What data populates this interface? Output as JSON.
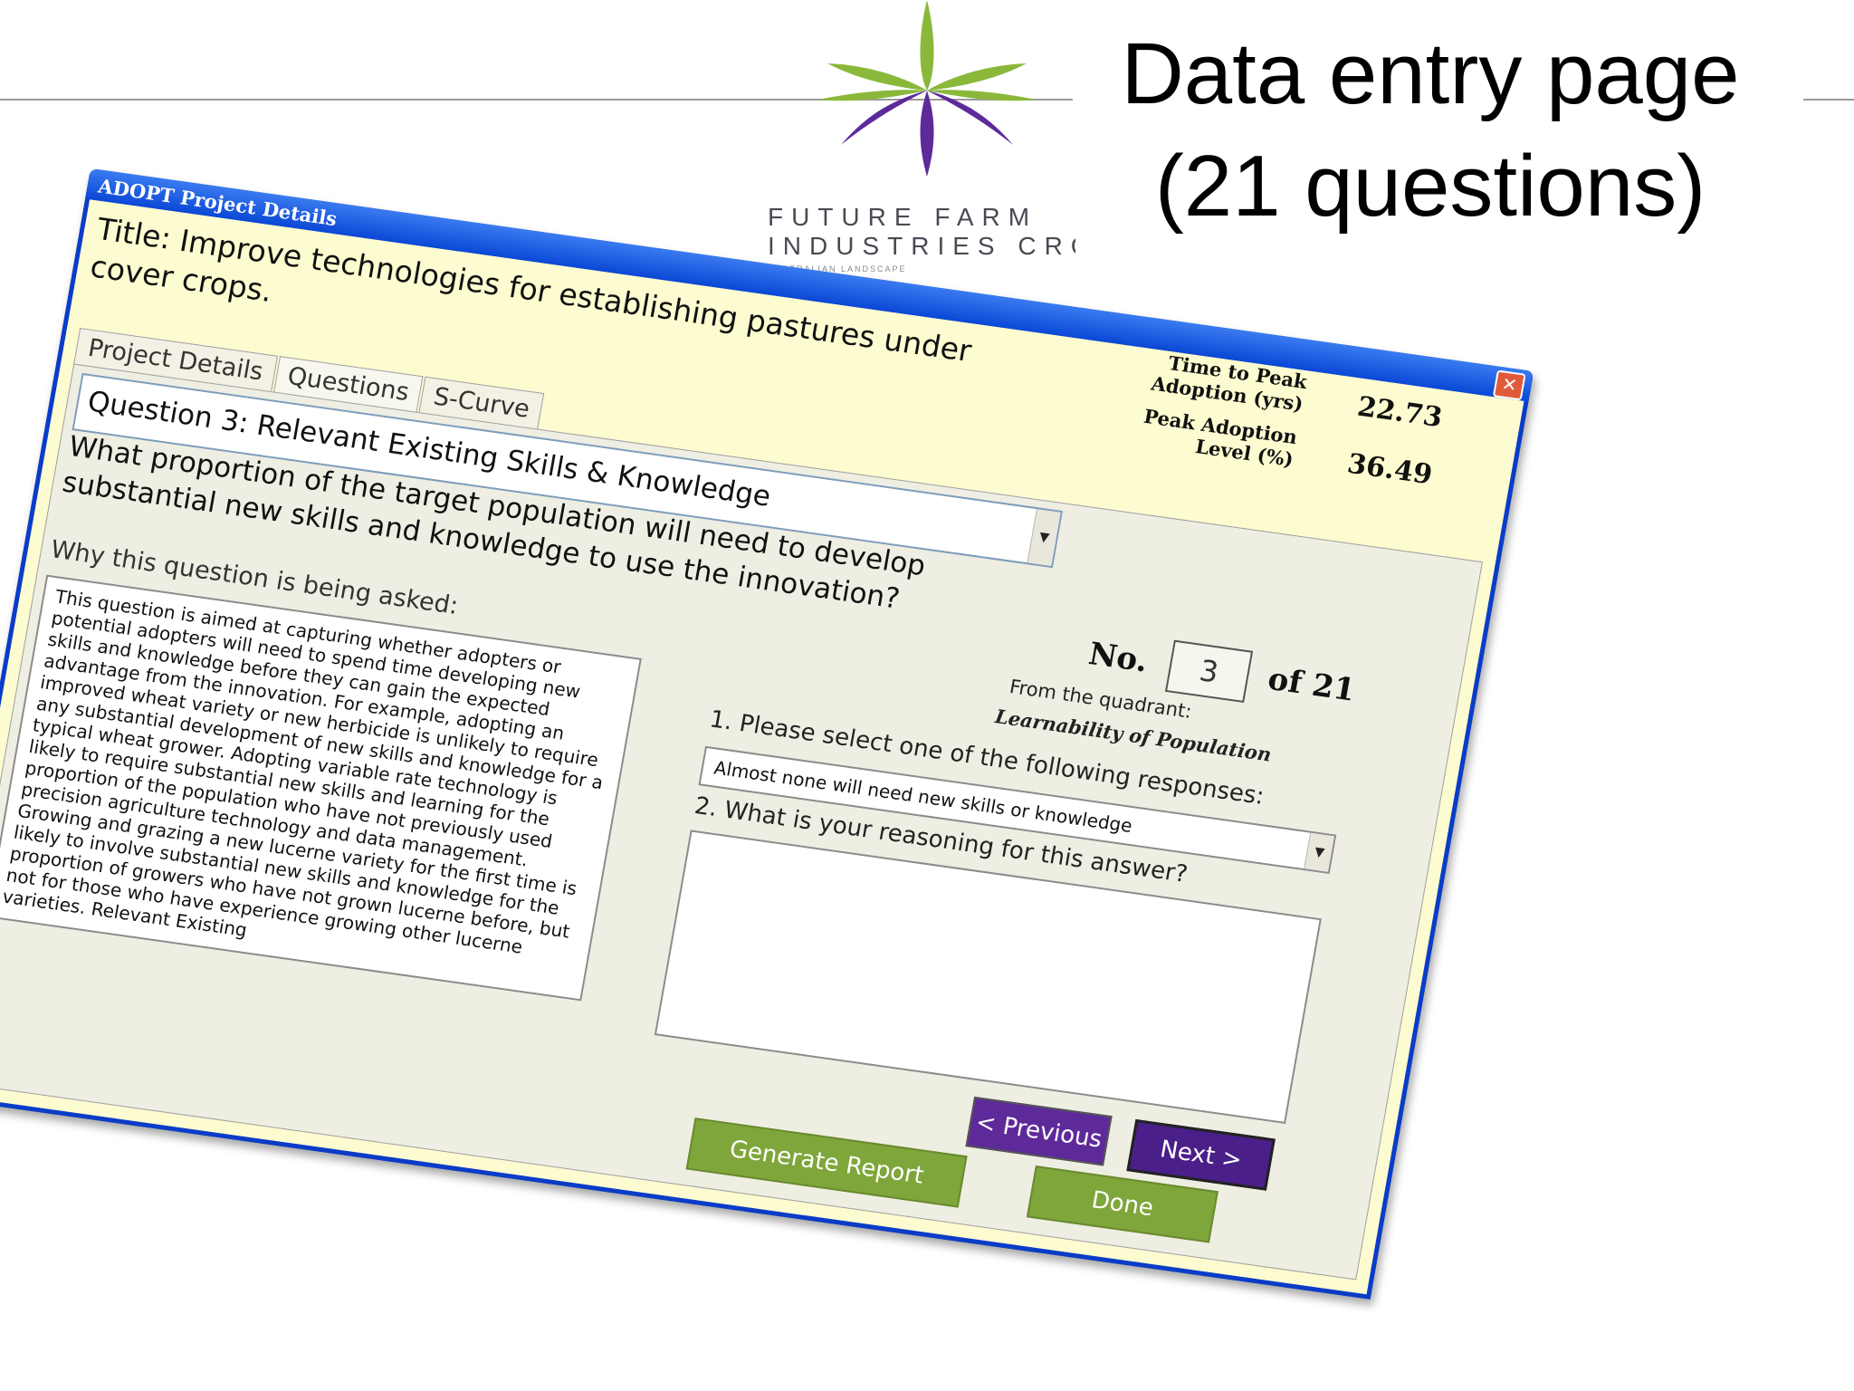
{
  "slide": {
    "title": "Data entry page (21 questions)"
  },
  "logo": {
    "line1": "FUTURE FARM",
    "line2": "INDUSTRIES CRC",
    "line3": "AUSTRALIAN LANDSCAPE",
    "colors": {
      "green": "#8ab83a",
      "purple": "#5e2a9a"
    }
  },
  "window": {
    "title": "ADOPT Project Details",
    "close_icon": "close-icon"
  },
  "project": {
    "title": "Title: Improve technologies for establishing pastures under cover crops."
  },
  "tabs": [
    {
      "label": "Project Details"
    },
    {
      "label": "Questions"
    },
    {
      "label": "S-Curve"
    }
  ],
  "question": {
    "selected": "Question 3: Relevant Existing Skills & Knowledge",
    "prompt": "What proportion of the target population will need to develop substantial new skills and knowledge to use the innovation?",
    "why_label": "Why this question is being asked:",
    "why_text": "This question is aimed at capturing whether adopters or potential adopters will need to spend time developing new skills and knowledge before they can gain the expected advantage from the innovation. For example, adopting an improved wheat variety or new herbicide is unlikely to require any substantial development of new skills and knowledge for a typical wheat grower. Adopting variable rate technology is likely to require substantial new skills and learning for the proportion of the population who have not previously used precision agriculture technology and data management. Growing and grazing a new lucerne variety for the first time is likely to involve substantial new skills and knowledge for the proportion of growers who have not grown lucerne before, but not for those who have experience growing other lucerne varieties. Relevant Existing"
  },
  "stats": {
    "time_label_1": "Time to Peak",
    "time_label_2": "Adoption (yrs)",
    "time_value": "22.73",
    "peak_label_1": "Peak Adoption",
    "peak_label_2": "Level (%)",
    "peak_value": "36.49"
  },
  "counter": {
    "no_label": "No.",
    "current": "3",
    "of_label": "of 21"
  },
  "quadrant": {
    "label": "From the quadrant:",
    "value": "Learnability of Population"
  },
  "response": {
    "label": "1. Please select one of the following responses:",
    "selected": "Almost none will need new skills or knowledge"
  },
  "reasoning": {
    "label": "2. What is your reasoning for this answer?",
    "value": ""
  },
  "buttons": {
    "previous": "< Previous",
    "next": "Next >",
    "report": "Generate Report",
    "done": "Done"
  }
}
